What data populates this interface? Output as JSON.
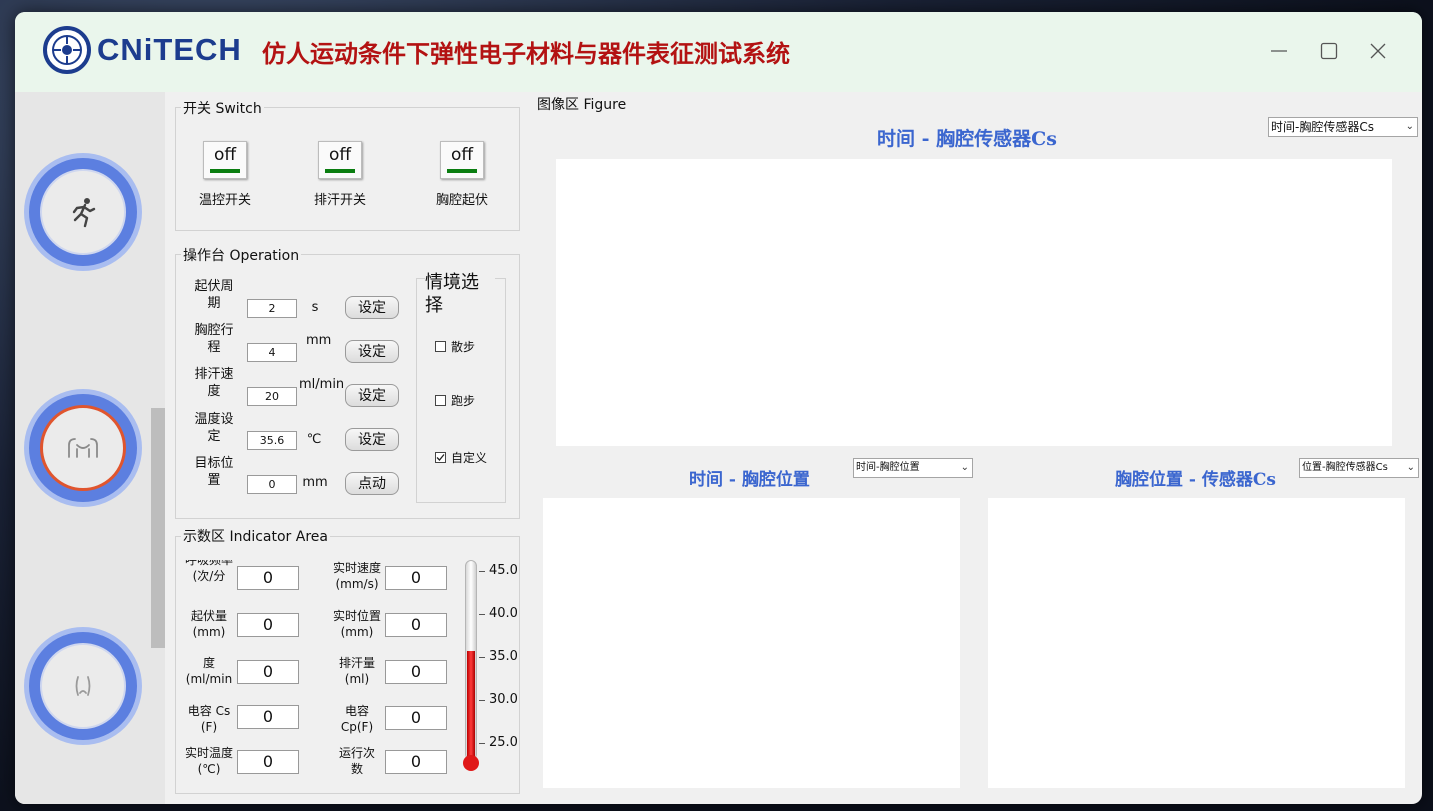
{
  "titlebar": {
    "logo_text": "CNiTECH",
    "app_title": "仿人运动条件下弹性电子材料与器件表征测试系统"
  },
  "nav": {
    "items": [
      {
        "icon": "running-person-icon",
        "active": false
      },
      {
        "icon": "chest-torso-icon",
        "active": true
      },
      {
        "icon": "waist-icon",
        "active": false
      }
    ],
    "accent_color": "#5c7fe0",
    "active_ring_color": "#e0552e"
  },
  "switch_group": {
    "label": "开关 Switch",
    "switches": [
      {
        "state": "off",
        "label": "温控开关"
      },
      {
        "state": "off",
        "label": "排汗开关"
      },
      {
        "state": "off",
        "label": "胸腔起伏"
      }
    ]
  },
  "operation_group": {
    "label": "操作台 Operation",
    "rows": [
      {
        "label": "起伏周期",
        "value": "2",
        "unit": "s",
        "button": "设定"
      },
      {
        "label": "胸腔行程",
        "value": "4",
        "unit": "mm",
        "button": "设定"
      },
      {
        "label": "排汗速度",
        "value": "20",
        "unit": "ml/min",
        "button": "设定"
      },
      {
        "label": "温度设定",
        "value": "35.6",
        "unit": "℃",
        "button": "设定"
      },
      {
        "label": "目标位置",
        "value": "0",
        "unit": "mm",
        "button": "点动"
      }
    ],
    "scenario": {
      "title": "情境选择",
      "options": [
        {
          "label": "散步",
          "checked": false
        },
        {
          "label": "跑步",
          "checked": false
        },
        {
          "label": "自定义",
          "checked": true
        }
      ]
    }
  },
  "indicator_group": {
    "label": "示数区 Indicator Area",
    "left": [
      {
        "label_line1": "呼吸频率",
        "label_line2": "(次/分",
        "value": "0"
      },
      {
        "label_line1": "起伏量",
        "label_line2": "(mm)",
        "value": "0"
      },
      {
        "label_line1": "度",
        "label_line2": "(ml/min",
        "value": "0"
      },
      {
        "label_line1": "电容 Cs",
        "label_line2": "(F)",
        "value": "0"
      },
      {
        "label_line1": "实时温度",
        "label_line2": "(℃)",
        "value": "0"
      }
    ],
    "right": [
      {
        "label_line1": "实时速度",
        "label_line2": "(mm/s)",
        "value": "0"
      },
      {
        "label_line1": "实时位置",
        "label_line2": "(mm)",
        "value": "0"
      },
      {
        "label_line1": "排汗量",
        "label_line2": "(ml)",
        "value": "0"
      },
      {
        "label_line1": "电容",
        "label_line2": "Cp(F)",
        "value": "0"
      },
      {
        "label_line1": "运行次",
        "label_line2": "数",
        "value": "0"
      }
    ],
    "thermometer": {
      "ticks": [
        "45.0",
        "40.0",
        "35.0",
        "30.0",
        "25.0"
      ],
      "level_fraction": 0.55,
      "fill_color": "#e01818"
    }
  },
  "figure_group": {
    "label": "图像区 Figure",
    "main_plot": {
      "title": "时间 - 胸腔传感器Cs",
      "selector": "时间-胸腔传感器Cs"
    },
    "left_plot": {
      "title": "时间 - 胸腔位置",
      "selector": "时间-胸腔位置"
    },
    "right_plot": {
      "title": "胸腔位置 - 传感器Cs",
      "selector": "位置-胸腔传感器Cs"
    }
  }
}
